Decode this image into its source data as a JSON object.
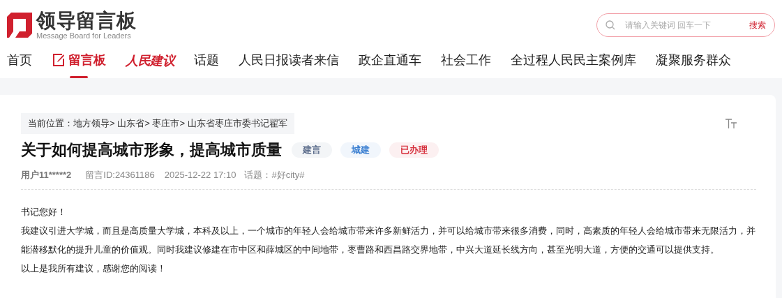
{
  "logo": {
    "title": "领导留言板",
    "subtitle": "Message Board for Leaders"
  },
  "search": {
    "placeholder": "请输入关键词 回车一下",
    "button": "搜索"
  },
  "nav": [
    {
      "label": "首页",
      "kind": "plain",
      "selected": false
    },
    {
      "label": "留言板",
      "kind": "icon",
      "selected": true
    },
    {
      "label": "人民建议",
      "kind": "script",
      "selected": false
    },
    {
      "label": "话题",
      "kind": "plain",
      "selected": false
    },
    {
      "label": "人民日报读者来信",
      "kind": "plain",
      "selected": false
    },
    {
      "label": "政企直通车",
      "kind": "plain",
      "selected": false
    },
    {
      "label": "社会工作",
      "kind": "plain",
      "selected": false
    },
    {
      "label": "全过程人民民主案例库",
      "kind": "plain",
      "selected": false
    },
    {
      "label": "凝聚服务群众",
      "kind": "plain",
      "selected": false
    }
  ],
  "breadcrumb": {
    "label": "当前位置：",
    "items": [
      "地方领导",
      "山东省",
      "枣庄市",
      "山东省枣庄市委书记翟军"
    ],
    "separator": ">"
  },
  "post": {
    "title": "关于如何提高城市形象，提高城市质量",
    "tags": [
      {
        "label": "建言",
        "color": "#5a6b8a"
      },
      {
        "label": "城建",
        "color": "#3b7fd1"
      },
      {
        "label": "已办理",
        "color": "#d6303d"
      }
    ],
    "author": "用户11*****2",
    "id": "留言ID:24361186",
    "time": "2025-12-22 17:10",
    "topic": "话题：#好city#",
    "body": [
      "书记您好！",
      "我建议引进大学城，而且是高质量大学城，本科及以上，一个城市的年轻人会给城市带来许多新鲜活力，并可以给城市带来很多消费，同时，高素质的年轻人会给城市带来无限活力，并能潜移默化的提升儿童的价值观。同时我建议修建在市中区和薛城区的中间地带，枣曹路和西昌路交界地带，中兴大道延长线方向，甚至光明大道，方便的交通可以提供支持。",
      "以上是我所有建议，感谢您的阅读！"
    ]
  }
}
